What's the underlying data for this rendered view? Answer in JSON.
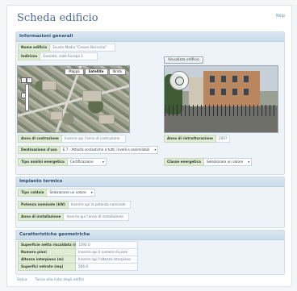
{
  "page": {
    "title": "Scheda edificio",
    "help_label": "Help"
  },
  "general": {
    "heading": "Informazioni generali",
    "name": {
      "label": "Nome edificio",
      "value": "Scuola Media \"Cesare Beccaria\""
    },
    "address": {
      "label": "Indirizzo",
      "value": "Gessate, viale Europa 1"
    },
    "map_tabs": [
      "Mappa",
      "Satellite",
      "Ibrida"
    ],
    "street_view_button": "Visualizza edificio",
    "year_built": {
      "label": "Anno di costruzione",
      "value": "Inserire qui l'anno di costruzione"
    },
    "year_renovated": {
      "label": "Anno di ristrutturazione",
      "value": "2007"
    },
    "use": {
      "label": "Destinazione d'uso",
      "value": "E.7 - Attività scolastiche a tutti i livelli e assimilabili"
    },
    "energy_analysis": {
      "label": "Tipo analisi energetica",
      "value": "Certificazione"
    },
    "energy_class": {
      "label": "Classe energetica",
      "value": "Selezionare un valore"
    }
  },
  "heating": {
    "heading": "Impianto termico",
    "boiler_type": {
      "label": "Tipo caldaia",
      "value": "Selezionare un valore"
    },
    "nominal_power": {
      "label": "Potenza nominale (kW)",
      "value": "Inserire qui la potenza nominale"
    },
    "install_year": {
      "label": "Anno di installazione",
      "value": "Inserire qui l'anno di installazione"
    }
  },
  "geometry": {
    "heading": "Caratteristiche geometriche",
    "heated_area": {
      "label": "Superficie netta riscaldata (mq)",
      "value": "1592.0"
    },
    "floors": {
      "label": "Numero piani",
      "value": "Inserire qui il numero di piani"
    },
    "floor_height": {
      "label": "Altezza interpiano (m)",
      "value": "Inserire qui l'altezza interpiano"
    },
    "glazed_area": {
      "label": "Superfici vetrate (mq)",
      "value": "566.0"
    }
  },
  "footer": {
    "save": "Salva",
    "back": "Torna alla lista degli edifici"
  }
}
